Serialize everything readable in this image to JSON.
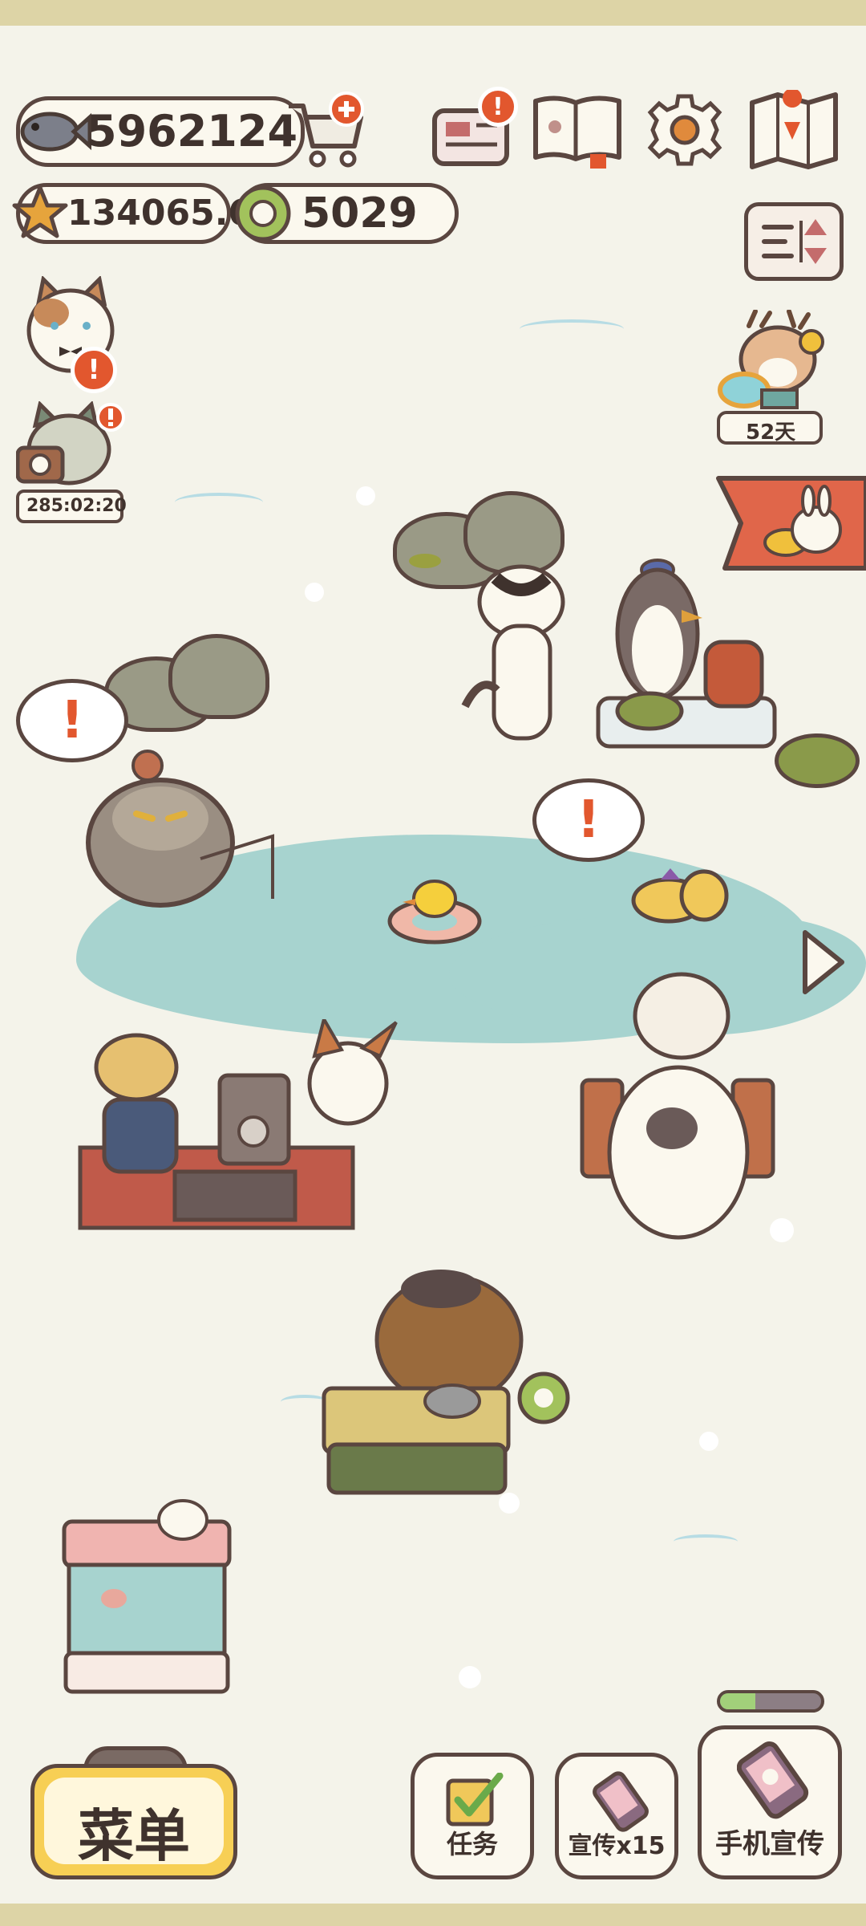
{
  "currency": {
    "fish_amount": "5962124",
    "star_amount": "134065.6",
    "token_amount": "5029"
  },
  "top_icons": {
    "news_badge": "!",
    "event_days": "52天"
  },
  "left_panel": {
    "cat_badge": "!",
    "camera_timer": "285:02:20"
  },
  "map_alerts": {
    "alert_mark": "!"
  },
  "bottom_bar": {
    "menu_label": "菜单",
    "tasks_label": "任务",
    "promo_label": "宣传x15",
    "phone_promo_label": "手机宣传",
    "phone_promo_progress": 0.35
  },
  "colors": {
    "accent_orange": "#e2572e",
    "lake": "#a7d3cf",
    "menu_yellow": "#f7cf55",
    "outline": "#5a4640"
  }
}
